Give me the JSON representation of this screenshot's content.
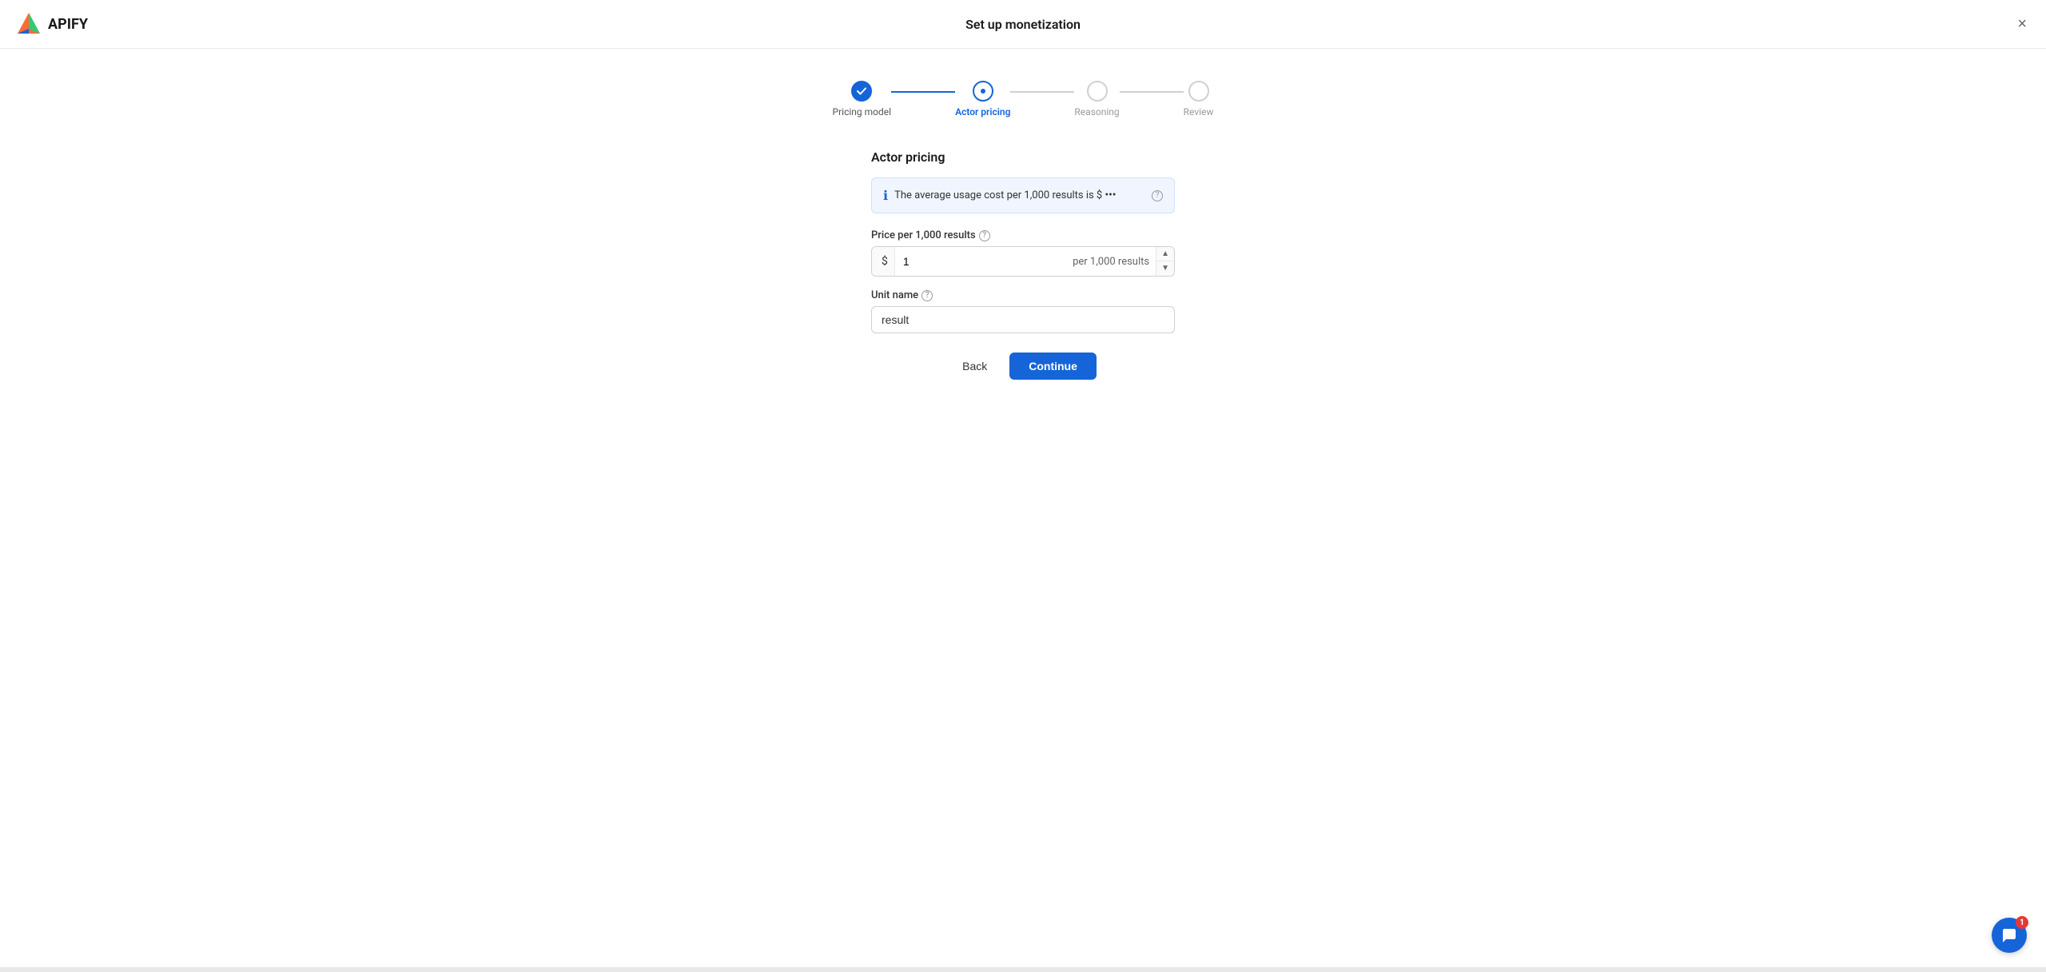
{
  "header": {
    "title": "Set up monetization",
    "logo_text": "APIFY",
    "close_label": "×"
  },
  "stepper": {
    "steps": [
      {
        "id": "pricing-model",
        "label": "Pricing model",
        "state": "completed"
      },
      {
        "id": "actor-pricing",
        "label": "Actor pricing",
        "state": "active"
      },
      {
        "id": "reasoning",
        "label": "Reasoning",
        "state": "inactive"
      },
      {
        "id": "review",
        "label": "Review",
        "state": "inactive"
      }
    ]
  },
  "form": {
    "section_title": "Actor pricing",
    "info_text": "The average usage cost per 1,000 results is $",
    "info_suffix": "",
    "price_field": {
      "label": "Price per 1,000 results",
      "prefix": "$",
      "value": "1",
      "suffix": "per 1,000 results"
    },
    "unit_name_field": {
      "label": "Unit name",
      "value": "result"
    }
  },
  "buttons": {
    "back_label": "Back",
    "continue_label": "Continue"
  },
  "chat": {
    "badge": "1"
  }
}
